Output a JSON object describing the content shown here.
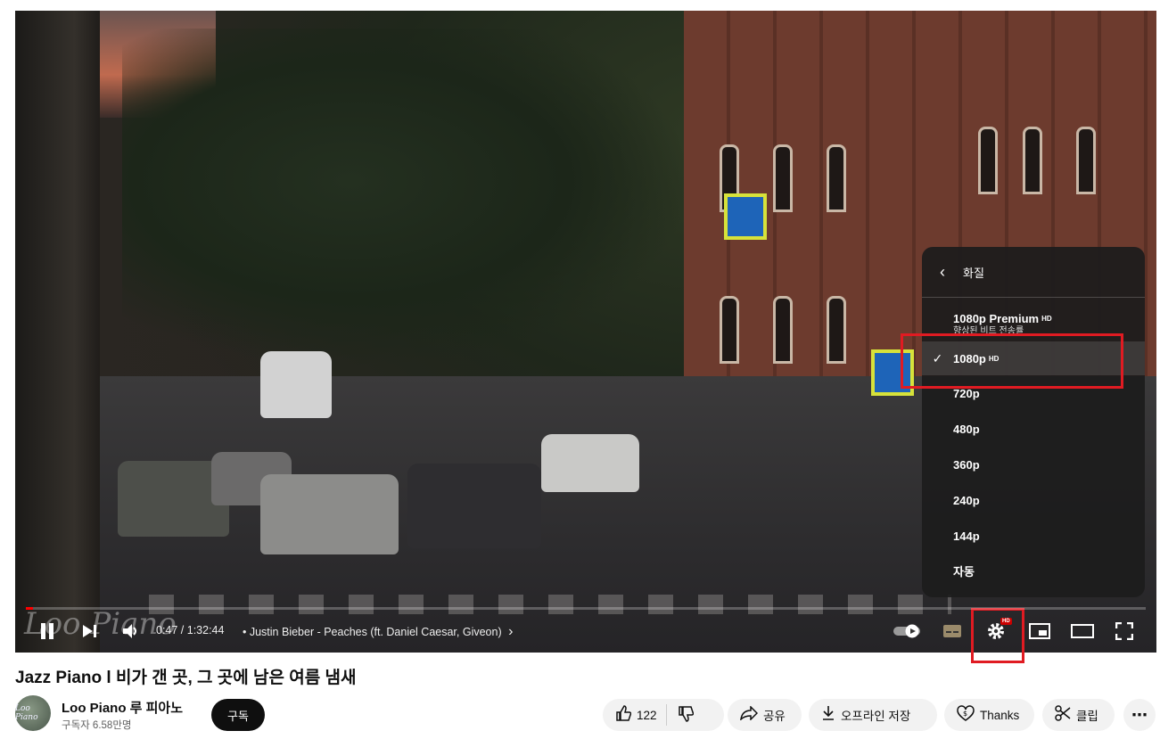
{
  "player": {
    "watermark": "Loo Piano",
    "progress_fraction": 0.006,
    "time_display": "0:47 / 1:32:44",
    "chapter_text": "•  Justin Bieber - Peaches (ft. Daniel Caesar, Giveon)",
    "chapter_arrow": "›",
    "settings_badge": "HD"
  },
  "quality_menu": {
    "header": "화질",
    "items": [
      {
        "label": "1080p Premium",
        "badge": "HD",
        "sub": "향상된 비트 전송률",
        "selected": false
      },
      {
        "label": "1080p",
        "badge": "HD",
        "selected": true
      },
      {
        "label": "720p",
        "selected": false
      },
      {
        "label": "480p",
        "selected": false
      },
      {
        "label": "360p",
        "selected": false
      },
      {
        "label": "240p",
        "selected": false
      },
      {
        "label": "144p",
        "selected": false
      },
      {
        "label": "자동",
        "selected": false
      }
    ],
    "check_mark": "✓"
  },
  "video": {
    "title": "Jazz Piano l 비가 갠 곳, 그 곳에 남은 여름 냄새",
    "channel": {
      "name": "Loo Piano 루 피아노",
      "subscribers": "구독자 6.58만명",
      "avatar_text": "Loo Piano",
      "subscribe_label": "구독"
    },
    "actions": {
      "like_count": "122",
      "share": "공유",
      "download": "오프라인 저장",
      "thanks": "Thanks",
      "clip": "클립",
      "more": "⋯"
    }
  },
  "colors": {
    "highlight_box": "#e01b22",
    "progress": "#ff0000"
  }
}
